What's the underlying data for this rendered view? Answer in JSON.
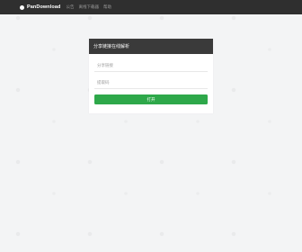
{
  "nav": {
    "brand": "PanDownload",
    "links": [
      "公告",
      "离线下载器",
      "帮助"
    ]
  },
  "form": {
    "title": "分享链接在线解析",
    "link_placeholder": "分享链接",
    "code_placeholder": "提取码",
    "submit_label": "打开"
  },
  "colors": {
    "navbar": "#2f2f2f",
    "panel_header": "#3a3a3a",
    "submit": "#2ea84a",
    "background": "#f3f4f5"
  }
}
